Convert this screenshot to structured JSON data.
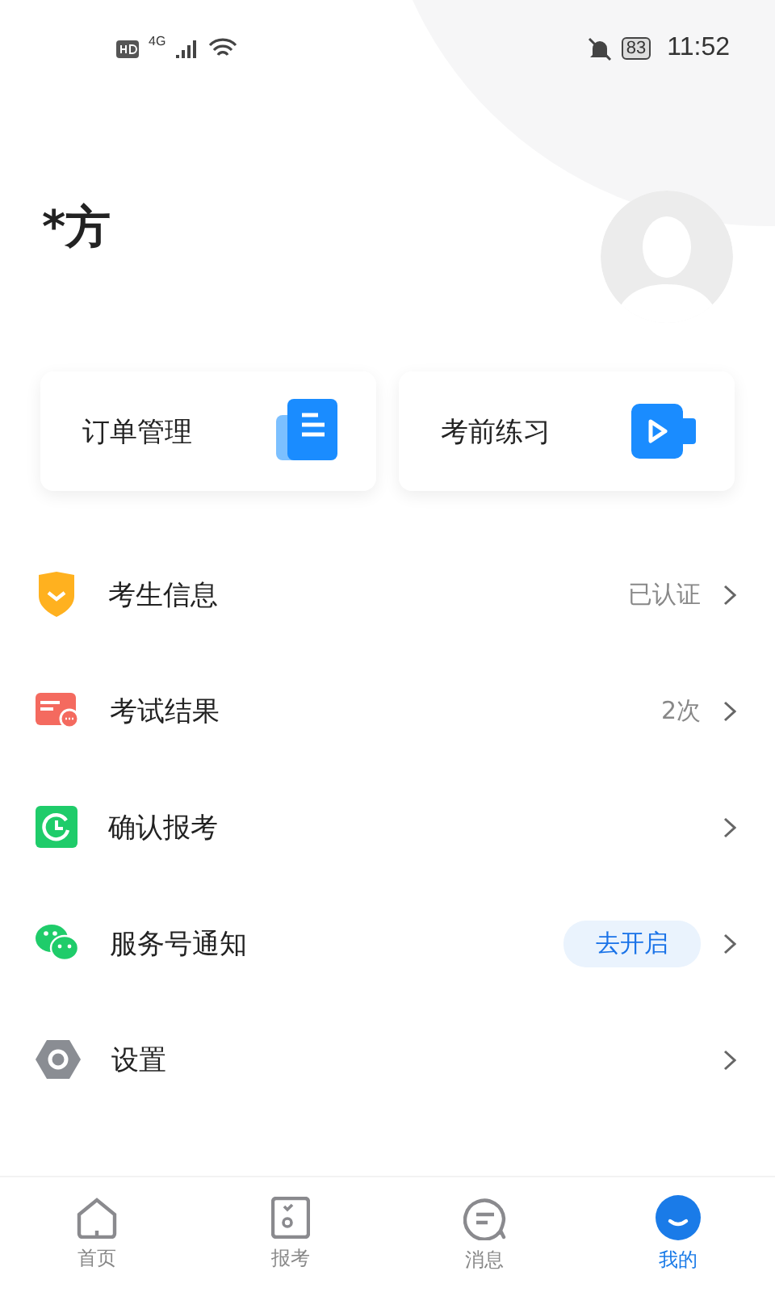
{
  "status_bar": {
    "battery": "83",
    "time": "11:52",
    "network": "4G"
  },
  "profile": {
    "name": "*方"
  },
  "cards": [
    {
      "label": "订单管理"
    },
    {
      "label": "考前练习"
    }
  ],
  "menu": [
    {
      "label": "考生信息",
      "value": "已认证",
      "kind": "text"
    },
    {
      "label": "考试结果",
      "value": "2次",
      "kind": "text"
    },
    {
      "label": "确认报考",
      "kind": "plain"
    },
    {
      "label": "服务号通知",
      "value": "去开启",
      "kind": "pill"
    },
    {
      "label": "设置",
      "kind": "plain"
    }
  ],
  "tabs": [
    {
      "label": "首页",
      "selected": false
    },
    {
      "label": "报考",
      "selected": false
    },
    {
      "label": "消息",
      "selected": false
    },
    {
      "label": "我的",
      "selected": true
    }
  ]
}
